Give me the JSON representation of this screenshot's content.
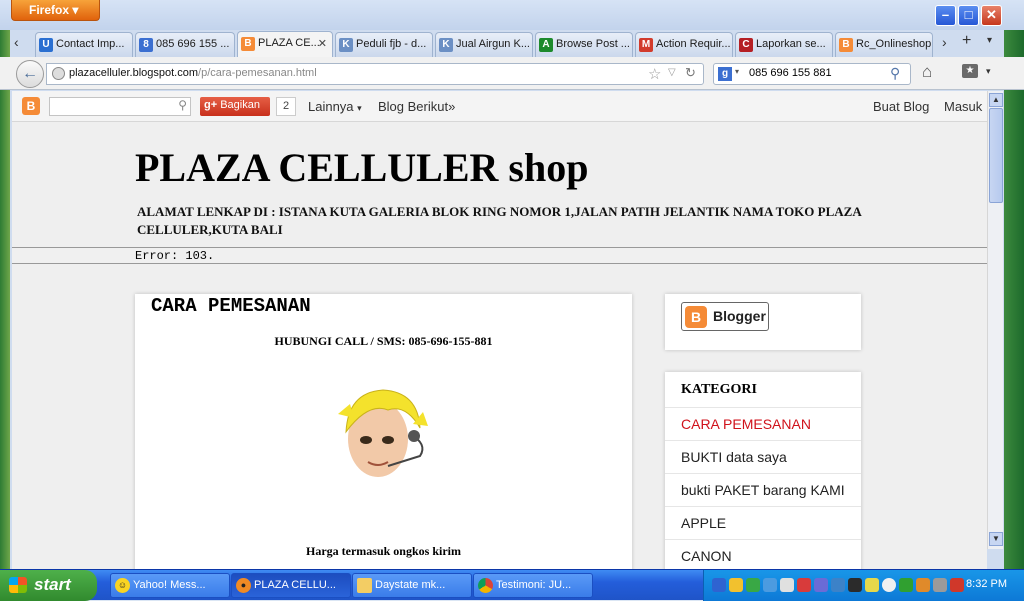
{
  "browser": {
    "menu_button": "Firefox",
    "tabs": [
      {
        "label": "Contact Imp...",
        "favicon": "U",
        "color": "#2a6fd1"
      },
      {
        "label": "085 696 155 ...",
        "favicon": "8",
        "color": "#3b6fd1"
      },
      {
        "label": "PLAZA CE...",
        "favicon": "B",
        "color": "#f58b37",
        "active": true
      },
      {
        "label": "Peduli fjb - d...",
        "favicon": "K",
        "color": "#6b8fc4"
      },
      {
        "label": "Jual Airgun K...",
        "favicon": "K",
        "color": "#6b8fc4"
      },
      {
        "label": "Browse Post ...",
        "favicon": "A",
        "color": "#1d8a2c"
      },
      {
        "label": "Action Requir...",
        "favicon": "M",
        "color": "#d23b2c"
      },
      {
        "label": "Laporkan se...",
        "favicon": "C",
        "color": "#b51f24"
      },
      {
        "label": "Rc_Onlineshop",
        "favicon": "B",
        "color": "#f58b37"
      }
    ],
    "url_host": "plazacelluler.blogspot.com",
    "url_path": "/p/cara-pemesanan.html",
    "search_value": "085 696 155 881"
  },
  "blogger_bar": {
    "share_label": "Bagikan",
    "share_count": "2",
    "more_label": "Lainnya",
    "next_blog_label": "Blog Berikut»",
    "create_blog_label": "Buat Blog",
    "login_label": "Masuk"
  },
  "site": {
    "title": "PLAZA CELLULER shop",
    "description": "ALAMAT LENKAP DI : ISTANA KUTA GALERIA BLOK RING NOMOR 1,JALAN PATIH JELANTIK NAMA TOKO PLAZA CELLULER,KUTA BALI",
    "error": "Error: 103."
  },
  "post": {
    "title": "CARA PEMESANAN",
    "call_line": "HUBUNGI CALL / SMS: 085-696-155-881",
    "price_line": "Harga termasuk ongkos kirim"
  },
  "sidebar": {
    "badge_label": "Blogger",
    "category_title": "KATEGORI",
    "categories": [
      "CARA PEMESANAN",
      "BUKTI data saya",
      "bukti PAKET barang KAMI",
      "APPLE",
      "CANON"
    ]
  },
  "taskbar": {
    "start_label": "start",
    "buttons": [
      "Yahoo! Mess...",
      "PLAZA CELLU...",
      "Daystate mk...",
      "Testimoni: JU..."
    ],
    "clock": "8:32 PM"
  }
}
